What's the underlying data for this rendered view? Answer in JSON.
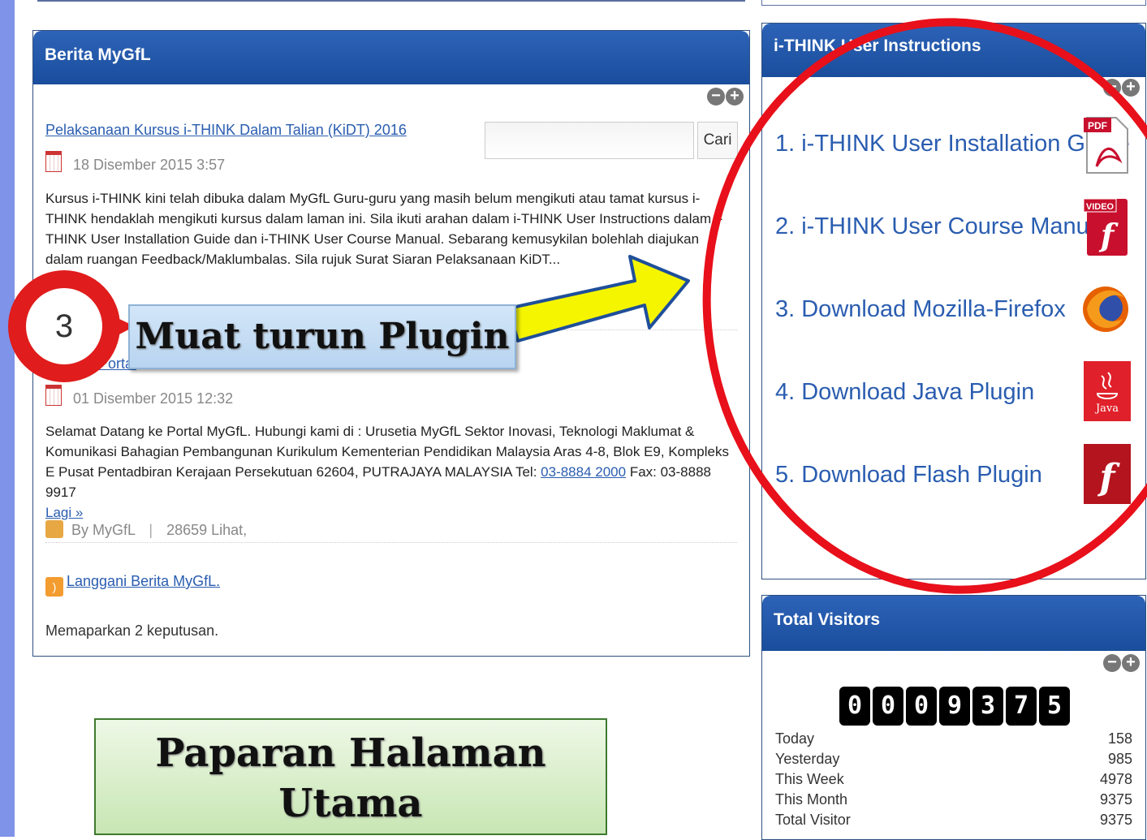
{
  "news": {
    "title": "Berita MyGfL",
    "search_button": "Cari",
    "search_value": "",
    "item1_title": "Pelaksanaan Kursus i-THINK Dalam Talian (KiDT) 2016",
    "item1_date": "18 Disember 2015 3:57",
    "item1_body": "Kursus i-THINK kini telah dibuka dalam MyGfL Guru-guru yang masih belum mengikuti atau tamat kursus i-THINK hendaklah mengikuti kursus dalam laman ini. Sila ikuti arahan dalam i-THINK User Instructions dalam i-THINK User Installation Guide dan i-THINK User Course Manual. Sebarang kemusykilan bolehlah diajukan dalam ruangan Feedback/Maklumbalas. Sila rujuk Surat Siaran Pelaksanaan KiDT...",
    "item2_title": "Portal",
    "item2_date": "01 Disember 2015 12:32",
    "item2_body_pre": "Selamat Datang ke Portal MyGfL. Hubungi kami di : Urusetia MyGfL Sektor Inovasi, Teknologi Maklumat & Komunikasi Bahagian Pembangunan Kurikulum Kementerian Pendidikan Malaysia Aras 4-8, Blok E9, Kompleks E Pusat Pentadbiran Kerajaan Persekutuan 62604, PUTRAJAYA MALAYSIA Tel: ",
    "item2_phone": "03-8884 2000",
    "item2_body_post": " Fax: 03-8888 9917",
    "item2_more": "Lagi »",
    "author": "By MyGfL",
    "separator": "|",
    "views": "28659 Lihat,",
    "rss_label": "Langgani Berita MyGfL.",
    "result_count": "Memaparkan 2 keputusan."
  },
  "instructions": {
    "title": "i-THINK User Instructions",
    "items": [
      {
        "label": "1. i-THINK User Installation Guide",
        "icon": "pdf-icon",
        "badge": "PDF"
      },
      {
        "label": "2. i-THINK User Course Manual",
        "icon": "video-flash-icon",
        "badge": "VIDEO"
      },
      {
        "label": "3. Download Mozilla-Firefox",
        "icon": "firefox-icon",
        "badge": ""
      },
      {
        "label": "4. Download Java Plugin",
        "icon": "java-icon",
        "badge": "Java"
      },
      {
        "label": "5. Download Flash Plugin",
        "icon": "flash-icon",
        "badge": ""
      }
    ]
  },
  "visitors": {
    "title": "Total Visitors",
    "digits": [
      "0",
      "0",
      "0",
      "9",
      "3",
      "7",
      "5"
    ],
    "stats": [
      {
        "label": "Today",
        "value": "158"
      },
      {
        "label": "Yesterday",
        "value": "985"
      },
      {
        "label": "This Week",
        "value": "4978"
      },
      {
        "label": "This Month",
        "value": "9375"
      },
      {
        "label": "Total Visitor",
        "value": "9375"
      }
    ]
  },
  "overlay": {
    "step_number": "3",
    "callout": "Muat turun Plugin",
    "caption_line1": "Paparan Halaman",
    "caption_line2": "Utama",
    "colors": {
      "circle": "#e8101a",
      "arrow": "#f5f500",
      "panel_header": "#1f55a8",
      "link": "#2a5db0"
    }
  }
}
